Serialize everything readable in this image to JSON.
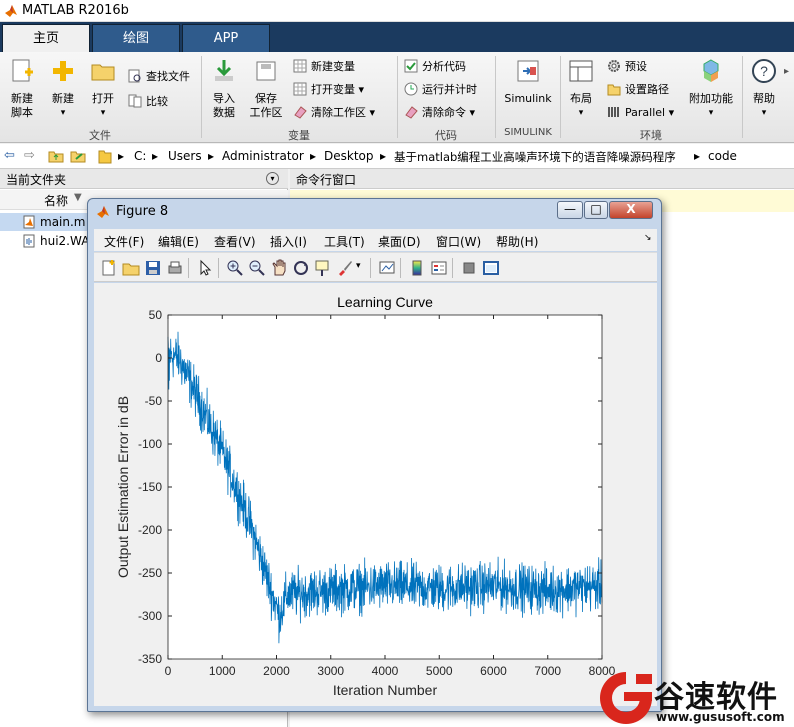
{
  "app": {
    "title": "MATLAB R2016b",
    "tabs": [
      "主页",
      "绘图",
      "APP"
    ],
    "active_tab": 0
  },
  "ribbon": {
    "file_group": {
      "label": "文件",
      "new_script": "新建\n脚本",
      "new": "新建",
      "open": "打开",
      "find_files": "查找文件",
      "compare": "比较"
    },
    "variable_group": {
      "label": "变量",
      "import_data": "导入\n数据",
      "save_workspace": "保存\n工作区",
      "new_variable": "新建变量",
      "open_variable": "打开变量",
      "clear_workspace": "清除工作区"
    },
    "code_group": {
      "label": "代码",
      "analyze_code": "分析代码",
      "run_and_time": "运行并计时",
      "clear_commands": "清除命令"
    },
    "simulink_group": {
      "label": "SIMULINK",
      "simulink": "Simulink"
    },
    "environment_group": {
      "label": "环境",
      "layout": "布局",
      "preferences": "预设",
      "set_path": "设置路径",
      "parallel": "Parallel",
      "add_ons": "附加功能"
    },
    "help": "帮助"
  },
  "address_bar": {
    "crumbs": [
      "C:",
      "Users",
      "Administrator",
      "Desktop",
      "基于matlab编程工业高噪声环境下的语音降噪源码程序",
      "code"
    ]
  },
  "current_folder": {
    "title": "当前文件夹",
    "column_name": "名称",
    "files": [
      "main.m",
      "hui2.WA"
    ]
  },
  "command_window": {
    "title": "命令行窗口"
  },
  "figure": {
    "title": "Figure 8",
    "menu": [
      "文件(F)",
      "编辑(E)",
      "查看(V)",
      "插入(I)",
      "工具(T)",
      "桌面(D)",
      "窗口(W)",
      "帮助(H)"
    ],
    "min_label": "—",
    "max_label": "□",
    "close_label": "X"
  },
  "watermark": {
    "brand": "谷速软件",
    "url": "www.gususoft.com",
    "color": "#d9261c"
  },
  "chart_data": {
    "type": "line",
    "title": "Learning Curve",
    "xlabel": "Iteration Number",
    "ylabel": "Output Estimation Error in dB",
    "xlim": [
      0,
      8000
    ],
    "ylim": [
      -350,
      50
    ],
    "xticks": [
      0,
      1000,
      2000,
      3000,
      4000,
      5000,
      6000,
      7000,
      8000
    ],
    "yticks": [
      50,
      0,
      -50,
      -100,
      -150,
      -200,
      -250,
      -300,
      -350
    ],
    "series": [
      {
        "color": "#0072bd",
        "trend_x": [
          0,
          200,
          500,
          1000,
          1500,
          1900,
          2050,
          2200,
          3000,
          4000,
          5000,
          6000,
          7000,
          8000
        ],
        "trend_y": [
          5,
          0,
          -40,
          -110,
          -190,
          -270,
          -300,
          -275,
          -270,
          -265,
          -268,
          -265,
          -270,
          -265
        ],
        "noise_amplitude_dB": 30
      }
    ],
    "grid": false
  }
}
